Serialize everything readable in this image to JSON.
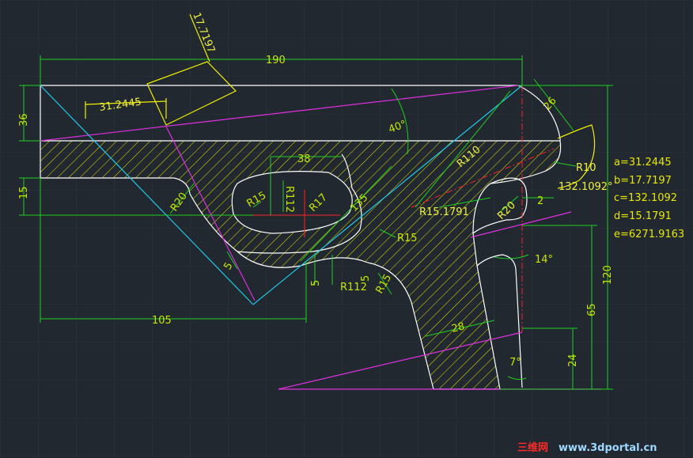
{
  "dimensions": {
    "top_length": "190",
    "left_height_top": "36",
    "left_height_mid": "15",
    "bottom_length": "105",
    "right_height_total": "120",
    "right_height_mid": "65",
    "right_height_low": "24",
    "aux_a": "31.2445",
    "aux_b": "17.7197",
    "angle_40": "40°",
    "angle_14": "14°",
    "angle_7": "7°",
    "angle_c": "132.1092°",
    "len_26": "26",
    "len_38": "38",
    "len_28": "28",
    "len_135": "135",
    "len_2": "2",
    "len_5a": "5",
    "len_5b": "5",
    "len_5c": "5"
  },
  "radii": {
    "r110": "R110",
    "r10": "R10",
    "r20_right": "R20",
    "r20_left": "R20",
    "r15_left": "R15",
    "r15_right": "R15",
    "r15_bottom": "R15",
    "r112_top": "R112",
    "r112_bottom": "R112",
    "r17": "R17",
    "r15_1791": "R15.1791"
  },
  "variables": [
    "a=31.2445",
    "b=17.7197",
    "c=132.1092",
    "d=15.1791",
    "e=6271.9163"
  ],
  "watermark": {
    "cn": "三维网",
    "url": "www.3dportal.cn"
  },
  "colors": {
    "background": "#212830",
    "outline": "#ffffff",
    "dimension": "#20d020",
    "dimension_text": "#c8e600",
    "hatch": "#e6e600",
    "center_line": "#ff2020",
    "magenta": "#e030e0",
    "cyan": "#20c8e8",
    "yellow_aux": "#f0f000",
    "watermark_red": "#ff2a2a",
    "watermark_blue": "#9fd8ff"
  }
}
